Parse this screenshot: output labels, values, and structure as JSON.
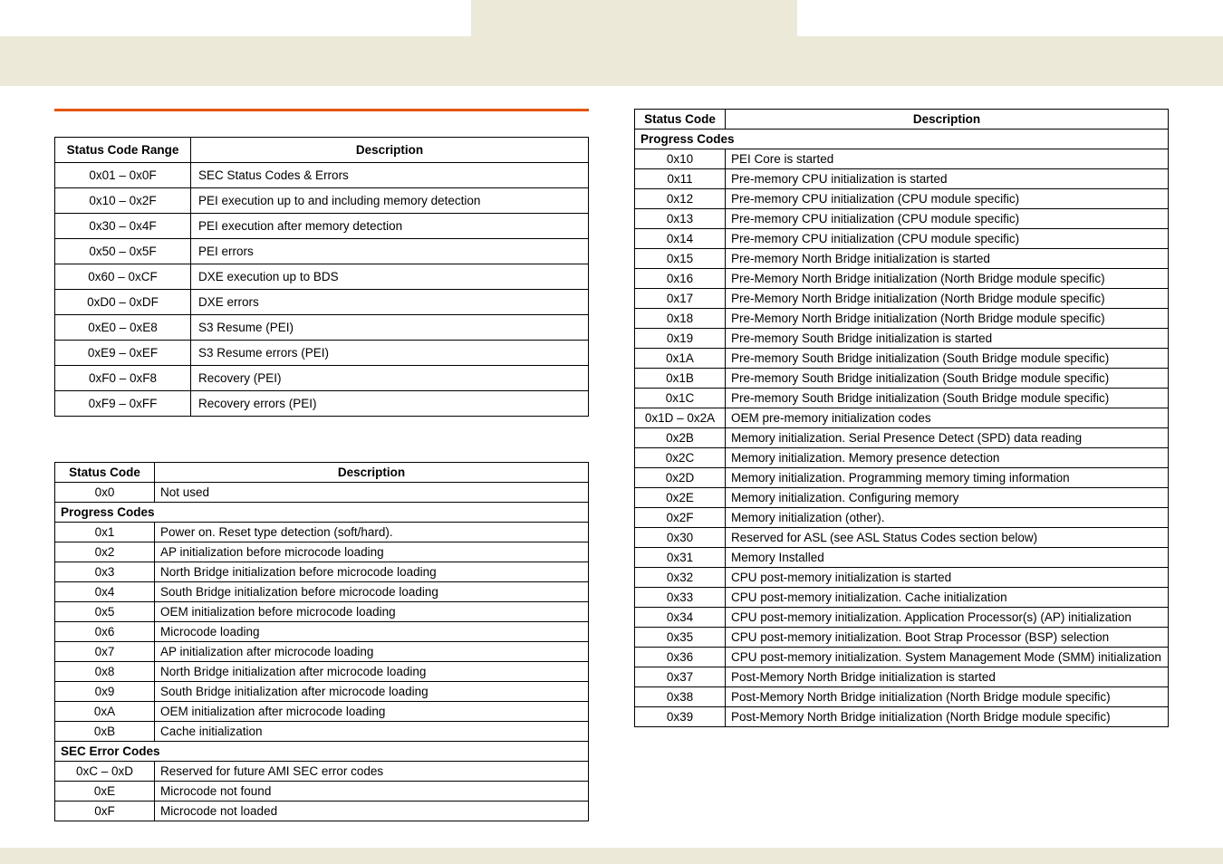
{
  "table1": {
    "headers": [
      "Status Code Range",
      "Description"
    ],
    "rows": [
      [
        "0x01 – 0x0F",
        "SEC Status Codes & Errors"
      ],
      [
        "0x10 – 0x2F",
        "PEI execution up to and including memory detection"
      ],
      [
        "0x30 – 0x4F",
        "PEI execution after memory detection"
      ],
      [
        "0x50 – 0x5F",
        "PEI errors"
      ],
      [
        "0x60 – 0xCF",
        "DXE execution up to BDS"
      ],
      [
        "0xD0 – 0xDF",
        "DXE errors"
      ],
      [
        "0xE0 – 0xE8",
        "S3 Resume (PEI)"
      ],
      [
        "0xE9 – 0xEF",
        "S3 Resume errors (PEI)"
      ],
      [
        "0xF0 – 0xF8",
        "Recovery (PEI)"
      ],
      [
        "0xF9 – 0xFF",
        "Recovery errors (PEI)"
      ]
    ]
  },
  "table2": {
    "headers": [
      "Status Code",
      "Description"
    ],
    "rows": [
      {
        "type": "row",
        "cells": [
          "0x0",
          "Not used"
        ]
      },
      {
        "type": "section",
        "label": "Progress Codes"
      },
      {
        "type": "row",
        "cells": [
          "0x1",
          "Power on. Reset type detection (soft/hard)."
        ]
      },
      {
        "type": "row",
        "cells": [
          "0x2",
          "AP initialization before microcode loading"
        ]
      },
      {
        "type": "row",
        "cells": [
          "0x3",
          "North Bridge initialization before microcode loading"
        ]
      },
      {
        "type": "row",
        "cells": [
          "0x4",
          "South Bridge initialization before microcode loading"
        ]
      },
      {
        "type": "row",
        "cells": [
          "0x5",
          "OEM initialization before microcode loading"
        ]
      },
      {
        "type": "row",
        "cells": [
          "0x6",
          "Microcode loading"
        ]
      },
      {
        "type": "row",
        "cells": [
          "0x7",
          "AP initialization after microcode loading"
        ]
      },
      {
        "type": "row",
        "cells": [
          "0x8",
          "North Bridge initialization after microcode loading"
        ]
      },
      {
        "type": "row",
        "cells": [
          "0x9",
          "South Bridge initialization after microcode loading"
        ]
      },
      {
        "type": "row",
        "cells": [
          "0xA",
          "OEM initialization after microcode loading"
        ]
      },
      {
        "type": "row",
        "cells": [
          "0xB",
          "Cache initialization"
        ]
      },
      {
        "type": "section",
        "label": "SEC Error Codes"
      },
      {
        "type": "row",
        "cells": [
          "0xC – 0xD",
          "Reserved for future AMI SEC error codes"
        ]
      },
      {
        "type": "row",
        "cells": [
          "0xE",
          "Microcode not found"
        ]
      },
      {
        "type": "row",
        "cells": [
          "0xF",
          "Microcode not loaded"
        ]
      }
    ]
  },
  "table3": {
    "headers": [
      "Status Code",
      "Description"
    ],
    "rows": [
      {
        "type": "section",
        "label": "Progress Codes"
      },
      {
        "type": "row",
        "cells": [
          "0x10",
          "PEI Core is started"
        ]
      },
      {
        "type": "row",
        "cells": [
          "0x11",
          "Pre-memory CPU initialization is started"
        ]
      },
      {
        "type": "row",
        "cells": [
          "0x12",
          "Pre-memory CPU initialization (CPU module specific)"
        ]
      },
      {
        "type": "row",
        "cells": [
          "0x13",
          "Pre-memory CPU initialization (CPU module specific)"
        ]
      },
      {
        "type": "row",
        "cells": [
          "0x14",
          "Pre-memory CPU initialization (CPU module specific)"
        ]
      },
      {
        "type": "row",
        "cells": [
          "0x15",
          "Pre-memory North Bridge initialization is started"
        ]
      },
      {
        "type": "row",
        "cells": [
          "0x16",
          "Pre-Memory North Bridge initialization (North Bridge module specific)"
        ]
      },
      {
        "type": "row",
        "cells": [
          "0x17",
          "Pre-Memory North Bridge initialization (North Bridge module specific)"
        ]
      },
      {
        "type": "row",
        "cells": [
          "0x18",
          "Pre-Memory North Bridge initialization (North Bridge module specific)"
        ]
      },
      {
        "type": "row",
        "cells": [
          "0x19",
          "Pre-memory South Bridge initialization is started"
        ]
      },
      {
        "type": "row",
        "cells": [
          "0x1A",
          "Pre-memory South Bridge initialization (South Bridge module specific)"
        ]
      },
      {
        "type": "row",
        "cells": [
          "0x1B",
          "Pre-memory South Bridge initialization (South Bridge module specific)"
        ]
      },
      {
        "type": "row",
        "cells": [
          "0x1C",
          "Pre-memory South Bridge initialization (South Bridge module specific)"
        ]
      },
      {
        "type": "row",
        "cells": [
          "0x1D – 0x2A",
          "OEM pre-memory initialization codes"
        ]
      },
      {
        "type": "row",
        "cells": [
          "0x2B",
          "Memory initialization. Serial Presence Detect (SPD) data reading"
        ]
      },
      {
        "type": "row",
        "cells": [
          "0x2C",
          "Memory initialization. Memory presence detection"
        ]
      },
      {
        "type": "row",
        "cells": [
          "0x2D",
          "Memory initialization. Programming memory timing information"
        ]
      },
      {
        "type": "row",
        "cells": [
          "0x2E",
          "Memory initialization. Configuring memory"
        ]
      },
      {
        "type": "row",
        "cells": [
          "0x2F",
          "Memory initialization (other)."
        ]
      },
      {
        "type": "row",
        "cells": [
          "0x30",
          "Reserved for ASL (see ASL Status Codes section below)"
        ]
      },
      {
        "type": "row",
        "cells": [
          "0x31",
          "Memory Installed"
        ]
      },
      {
        "type": "row",
        "cells": [
          "0x32",
          "CPU post-memory initialization is started"
        ]
      },
      {
        "type": "row",
        "cells": [
          "0x33",
          "CPU post-memory initialization. Cache initialization"
        ]
      },
      {
        "type": "row",
        "cells": [
          "0x34",
          "CPU post-memory initialization. Application Processor(s) (AP) initialization"
        ]
      },
      {
        "type": "row",
        "cells": [
          "0x35",
          "CPU post-memory initialization.  Boot Strap Processor (BSP) selection"
        ]
      },
      {
        "type": "row",
        "cells": [
          "0x36",
          "CPU post-memory initialization. System Management Mode (SMM) initialization"
        ]
      },
      {
        "type": "row",
        "cells": [
          "0x37",
          "Post-Memory North Bridge initialization is started"
        ]
      },
      {
        "type": "row",
        "cells": [
          "0x38",
          "Post-Memory North Bridge initialization (North Bridge module specific)"
        ]
      },
      {
        "type": "row",
        "cells": [
          "0x39",
          "Post-Memory North Bridge initialization (North Bridge module specific)"
        ]
      }
    ]
  }
}
